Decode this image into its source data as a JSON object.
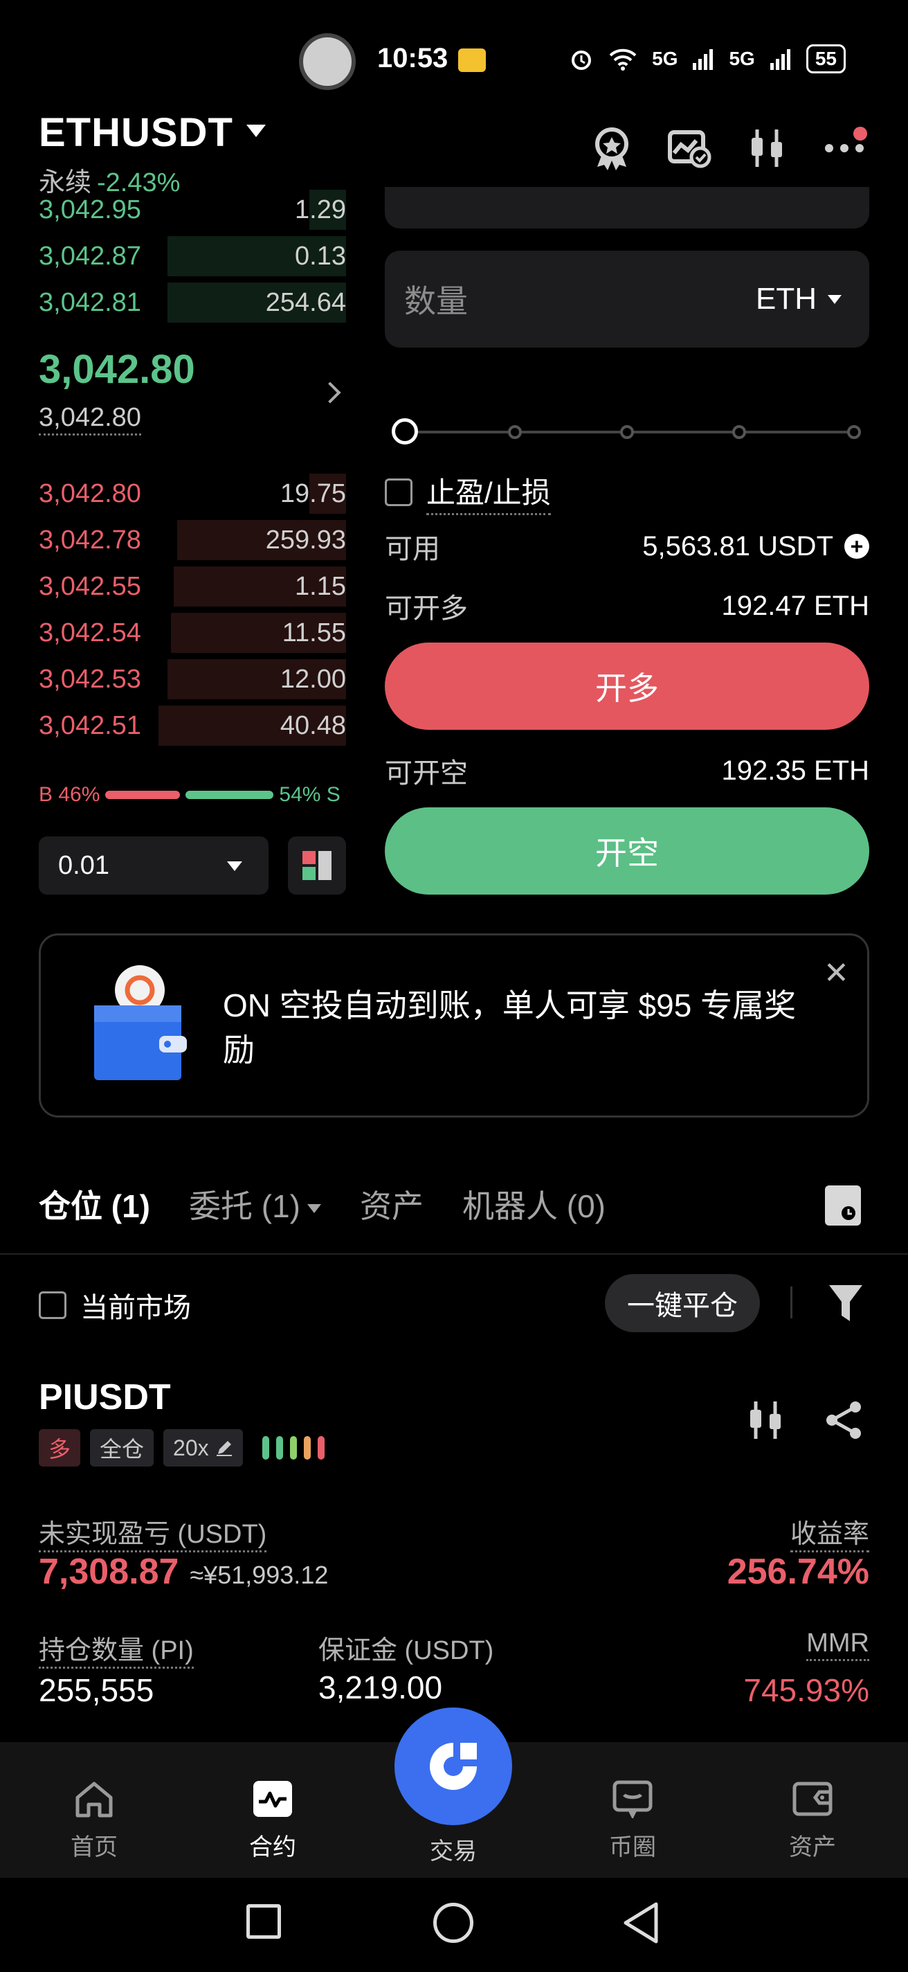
{
  "status_bar": {
    "time": "10:53",
    "network_a": "5G",
    "network_b": "5G",
    "battery": "55"
  },
  "header": {
    "symbol": "ETHUSDT",
    "contract_type": "永续",
    "change_pct": "-2.43%"
  },
  "order_book": {
    "asks": [
      {
        "price": "3,042.95",
        "size": "1.29",
        "depth": 0.12
      },
      {
        "price": "3,042.87",
        "size": "0.13",
        "depth": 0.58
      },
      {
        "price": "3,042.81",
        "size": "254.64",
        "depth": 0.58
      }
    ],
    "last_price": "3,042.80",
    "mark_price": "3,042.80",
    "bids": [
      {
        "price": "3,042.80",
        "size": "19.75",
        "depth": 0.12
      },
      {
        "price": "3,042.78",
        "size": "259.93",
        "depth": 0.55
      },
      {
        "price": "3,042.55",
        "size": "1.15",
        "depth": 0.56
      },
      {
        "price": "3,042.54",
        "size": "11.55",
        "depth": 0.57
      },
      {
        "price": "3,042.53",
        "size": "12.00",
        "depth": 0.58
      },
      {
        "price": "3,042.51",
        "size": "40.48",
        "depth": 0.61
      }
    ],
    "buy_label": "B 46%",
    "sell_label": "54% S",
    "buy_ratio": 0.46,
    "precision": "0.01"
  },
  "order_form": {
    "qty_placeholder": "数量",
    "qty_unit": "ETH",
    "tpsl_label": "止盈/止损",
    "available_label": "可用",
    "available_value": "5,563.81",
    "available_unit": "USDT",
    "max_long_label": "可开多",
    "max_long_value": "192.47 ETH",
    "open_long_label": "开多",
    "max_short_label": "可开空",
    "max_short_value": "192.35 ETH",
    "open_short_label": "开空"
  },
  "banner": {
    "text": "ON 空投自动到账，单人可享 $95 专属奖励"
  },
  "tabs": [
    {
      "label": "仓位 (1)"
    },
    {
      "label": "委托 (1)"
    },
    {
      "label": "资产"
    },
    {
      "label": "机器人 (0)"
    }
  ],
  "positions_toolbar": {
    "current_market_label": "当前市场",
    "close_all_label": "一键平仓"
  },
  "position": {
    "symbol": "PIUSDT",
    "side_tag": "多",
    "margin_mode_tag": "全仓",
    "leverage_tag": "20x",
    "risk_level_bars": 5,
    "unrealized_label": "未实现盈亏 (USDT)",
    "unrealized_value": "7,308.87",
    "unrealized_cny": "≈¥51,993.12",
    "roe_label": "收益率",
    "roe_value": "256.74%",
    "size_label": "持仓数量 (PI)",
    "size_value": "255,555",
    "margin_label": "保证金 (USDT)",
    "margin_value": "3,219.00",
    "mmr_label": "MMR",
    "mmr_value": "745.93%"
  },
  "bottom_nav": [
    {
      "label": "首页",
      "icon": "home-icon"
    },
    {
      "label": "合约",
      "icon": "futures-icon"
    },
    {
      "label": "交易",
      "icon": "trade-icon"
    },
    {
      "label": "币圈",
      "icon": "feed-icon"
    },
    {
      "label": "资产",
      "icon": "wallet-icon"
    }
  ],
  "colors": {
    "green": "#5cc48a",
    "red": "#ea5f6a",
    "trade_blue": "#3b6ff0"
  }
}
